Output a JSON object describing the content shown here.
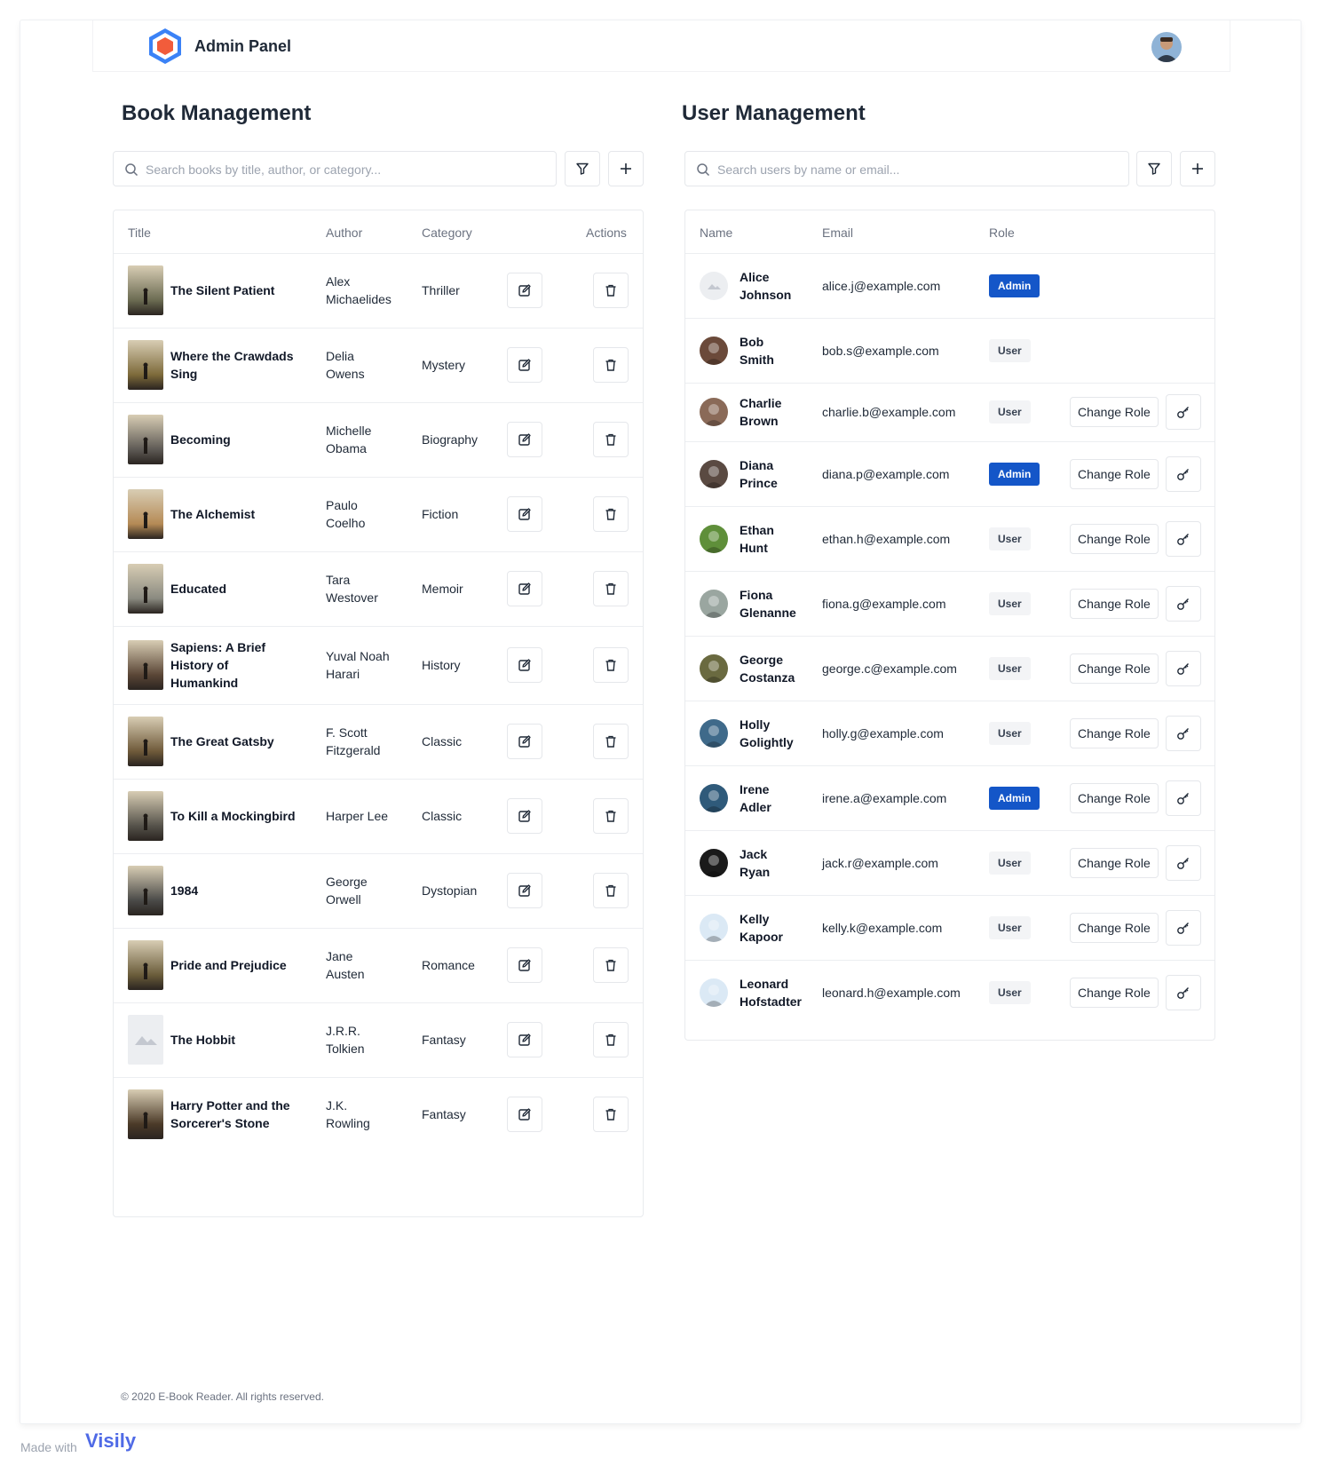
{
  "header": {
    "app_title": "Admin Panel",
    "logo_icon": "hexagon-logo-icon",
    "avatar_icon": "user-avatar-icon"
  },
  "books": {
    "title": "Book Management",
    "search_placeholder": "Search books by title, author, or category...",
    "columns": {
      "title": "Title",
      "author": "Author",
      "category": "Category",
      "actions": "Actions"
    },
    "rows": [
      {
        "title": [
          "The Silent Patient"
        ],
        "author": [
          "Alex",
          "Michaelides"
        ],
        "category": "Thriller",
        "cover": "#6b6b52"
      },
      {
        "title": [
          "Where the Crawdads",
          "Sing"
        ],
        "author": [
          "Delia",
          "Owens"
        ],
        "category": "Mystery",
        "cover": "#7d6a3a"
      },
      {
        "title": [
          "Becoming"
        ],
        "author": [
          "Michelle",
          "Obama"
        ],
        "category": "Biography",
        "cover": "#5e5a55"
      },
      {
        "title": [
          "The Alchemist"
        ],
        "author": [
          "Paulo",
          "Coelho"
        ],
        "category": "Fiction",
        "cover": "#b58a55"
      },
      {
        "title": [
          "Educated"
        ],
        "author": [
          "Tara",
          "Westover"
        ],
        "category": "Memoir",
        "cover": "#8a8a80"
      },
      {
        "title": [
          "Sapiens: A Brief",
          "History of",
          "Humankind"
        ],
        "author": [
          "Yuval Noah",
          "Harari"
        ],
        "category": "History",
        "cover": "#5a4636"
      },
      {
        "title": [
          "The Great Gatsby"
        ],
        "author": [
          "F. Scott",
          "Fitzgerald"
        ],
        "category": "Classic",
        "cover": "#6f5a3a"
      },
      {
        "title": [
          "To Kill a Mockingbird"
        ],
        "author": [
          "Harper Lee"
        ],
        "category": "Classic",
        "cover": "#55524a"
      },
      {
        "title": [
          "1984"
        ],
        "author": [
          "George",
          "Orwell"
        ],
        "category": "Dystopian",
        "cover": "#4a4a48"
      },
      {
        "title": [
          "Pride and Prejudice"
        ],
        "author": [
          "Jane",
          "Austen"
        ],
        "category": "Romance",
        "cover": "#6a5c3a"
      },
      {
        "title": [
          "The Hobbit"
        ],
        "author": [
          "J.R.R.",
          "Tolkien"
        ],
        "category": "Fantasy",
        "cover": "placeholder"
      },
      {
        "title": [
          "Harry Potter and the",
          "Sorcerer's Stone"
        ],
        "author": [
          "J.K.",
          "Rowling"
        ],
        "category": "Fantasy",
        "cover": "#4b3a28"
      }
    ]
  },
  "users": {
    "title": "User Management",
    "search_placeholder": "Search users by name or email...",
    "columns": {
      "name": "Name",
      "email": "Email",
      "role": "Role"
    },
    "change_role_label": "Change Role",
    "rows": [
      {
        "name": [
          "Alice",
          "Johnson"
        ],
        "email": "alice.j@example.com",
        "role": "Admin",
        "avatar": "placeholder",
        "has_actions": false
      },
      {
        "name": [
          "Bob",
          "Smith"
        ],
        "email": "bob.s@example.com",
        "role": "User",
        "avatar": "#6b4a3a",
        "has_actions": false
      },
      {
        "name": [
          "Charlie",
          "Brown"
        ],
        "email": "charlie.b@example.com",
        "role": "User",
        "avatar": "#8a6a58",
        "has_actions": true
      },
      {
        "name": [
          "Diana",
          "Prince"
        ],
        "email": "diana.p@example.com",
        "role": "Admin",
        "avatar": "#5a4a42",
        "has_actions": true
      },
      {
        "name": [
          "Ethan",
          "Hunt"
        ],
        "email": "ethan.h@example.com",
        "role": "User",
        "avatar": "#5f8f3a",
        "has_actions": true
      },
      {
        "name": [
          "Fiona",
          "Glenanne"
        ],
        "email": "fiona.g@example.com",
        "role": "User",
        "avatar": "#9aa6a0",
        "has_actions": true
      },
      {
        "name": [
          "George",
          "Costanza"
        ],
        "email": "george.c@example.com",
        "role": "User",
        "avatar": "#6a6a40",
        "has_actions": true
      },
      {
        "name": [
          "Holly",
          "Golightly"
        ],
        "email": "holly.g@example.com",
        "role": "User",
        "avatar": "#3f6a8a",
        "has_actions": true
      },
      {
        "name": [
          "Irene",
          "Adler"
        ],
        "email": "irene.a@example.com",
        "role": "Admin",
        "avatar": "#2f5a7a",
        "has_actions": true
      },
      {
        "name": [
          "Jack",
          "Ryan"
        ],
        "email": "jack.r@example.com",
        "role": "User",
        "avatar": "#1a1a1a",
        "has_actions": true
      },
      {
        "name": [
          "Kelly",
          "Kapoor"
        ],
        "email": "kelly.k@example.com",
        "role": "User",
        "avatar": "#dbe9f5",
        "has_actions": true
      },
      {
        "name": [
          "Leonard",
          "Hofstadter"
        ],
        "email": "leonard.h@example.com",
        "role": "User",
        "avatar": "#dbe9f5",
        "has_actions": true
      }
    ]
  },
  "footer": {
    "copyright": "© 2020 E-Book Reader. All rights reserved."
  },
  "watermark": {
    "made_with": "Made with",
    "brand": "Visily"
  },
  "colors": {
    "admin_badge": "#1456c8",
    "user_badge": "#f3f4f6",
    "logo_blue": "#4a90e2",
    "logo_orange": "#f25c3b"
  }
}
